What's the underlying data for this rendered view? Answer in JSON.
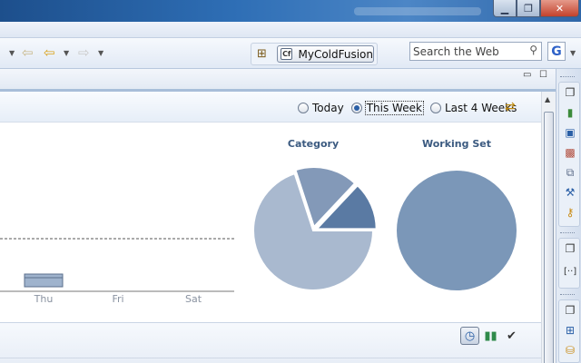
{
  "toolbar": {
    "perspective_label": "MyColdFusion",
    "perspective_badge": "Cf",
    "search_placeholder": "Search the Web",
    "google_label": "G"
  },
  "time_range": {
    "options": [
      {
        "label": "Today",
        "selected": false
      },
      {
        "label": "This Week",
        "selected": true
      },
      {
        "label": "Last 4 Weeks",
        "selected": false
      }
    ]
  },
  "chart_data": [
    {
      "type": "bar",
      "categories": [
        "Thu",
        "Fri",
        "Sat"
      ],
      "values": [
        1,
        0,
        0
      ],
      "xlabel": "",
      "ylabel": "",
      "grid": false
    },
    {
      "type": "pie",
      "title": "Category",
      "slices": [
        {
          "value": 70,
          "color": "#a9b9cf"
        },
        {
          "value": 17,
          "color": "#8399b8"
        },
        {
          "value": 13,
          "color": "#5a7aa3"
        }
      ]
    },
    {
      "type": "pie",
      "title": "Working Set",
      "slices": [
        {
          "value": 100,
          "color": "#7b97b8"
        }
      ]
    }
  ],
  "colors": {
    "accent": "#2a5fa6",
    "bar": "#9fb3cd"
  }
}
